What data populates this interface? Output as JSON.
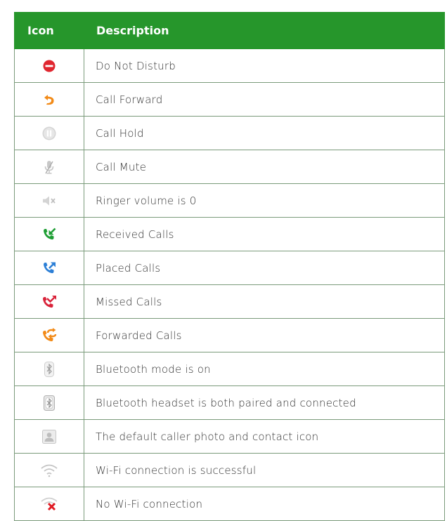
{
  "table": {
    "header": {
      "icon": "Icon",
      "description": "Description"
    },
    "rows": [
      {
        "icon": "do-not-disturb-icon",
        "description": "Do Not Disturb"
      },
      {
        "icon": "call-forward-icon",
        "description": "Call Forward"
      },
      {
        "icon": "call-hold-icon",
        "description": "Call Hold"
      },
      {
        "icon": "call-mute-icon",
        "description": "Call Mute"
      },
      {
        "icon": "ringer-volume-zero-icon",
        "description": "Ringer volume is 0"
      },
      {
        "icon": "received-calls-icon",
        "description": "Received Calls"
      },
      {
        "icon": "placed-calls-icon",
        "description": "Placed Calls"
      },
      {
        "icon": "missed-calls-icon",
        "description": "Missed Calls"
      },
      {
        "icon": "forwarded-calls-icon",
        "description": "Forwarded Calls"
      },
      {
        "icon": "bluetooth-mode-icon",
        "description": "Bluetooth mode is on"
      },
      {
        "icon": "bluetooth-headset-icon",
        "description": "Bluetooth headset is both paired and connected"
      },
      {
        "icon": "default-caller-photo-icon",
        "description": "The default caller photo and contact icon"
      },
      {
        "icon": "wifi-connected-icon",
        "description": "Wi-Fi connection is successful"
      },
      {
        "icon": "no-wifi-icon",
        "description": "No Wi-Fi connection"
      }
    ]
  },
  "colors": {
    "header_bg": "#26962b",
    "dnd": "#e0262f",
    "forward": "#f28a17",
    "received": "#1e9e34",
    "placed": "#2c7fd6",
    "missed": "#d9233a",
    "forwarded": "#f28a17",
    "no_wifi_x": "#e01b24"
  }
}
